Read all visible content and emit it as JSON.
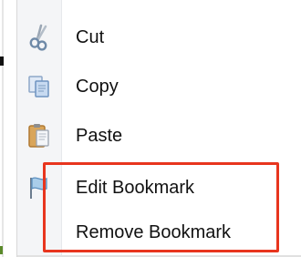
{
  "context_menu": {
    "items": [
      {
        "label": "Cut",
        "icon": "scissors-icon"
      },
      {
        "label": "Copy",
        "icon": "copy-icon"
      },
      {
        "label": "Paste",
        "icon": "clipboard-icon"
      },
      {
        "label": "Edit Bookmark",
        "icon": "flag-icon"
      },
      {
        "label": "Remove Bookmark",
        "icon": ""
      }
    ]
  },
  "colors": {
    "highlight_border": "#e8351e",
    "gutter": "#f4f5f7",
    "text": "#111111"
  }
}
